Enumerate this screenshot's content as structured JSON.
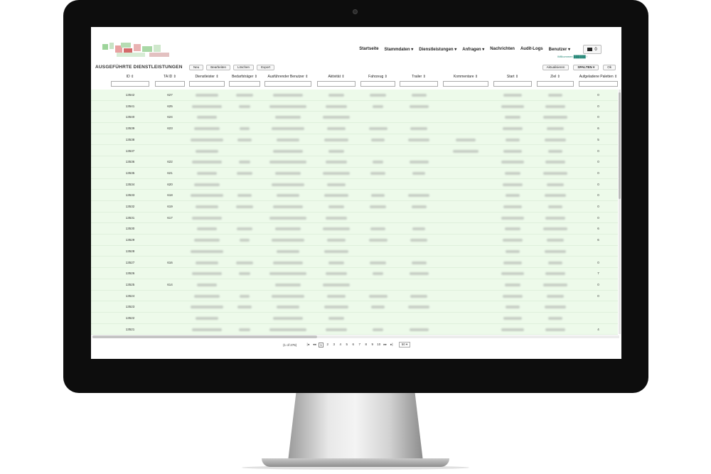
{
  "app": {
    "nav": [
      "Startseite",
      "Stammdaten ▾",
      "Dienstleistungen ▾",
      "Anfragen ▾",
      "Nachrichten",
      "Audit-Logs",
      "Benutzer ▾"
    ],
    "message_count": "0",
    "welcome_text": "Willkommen ██████ !",
    "page_title": "AUSGEFÜHRTE DIENSTLEISTUNGEN",
    "toolbar": [
      "Neu",
      "Bearbeiten",
      "Löschen",
      "Export"
    ],
    "right_tools": [
      "Aktualisieren",
      "SPALTEN ▾",
      "Ok"
    ]
  },
  "table": {
    "columns": [
      {
        "label": "ID ⇕"
      },
      {
        "label": "TA ID ⇕"
      },
      {
        "label": "Dienstleister ⇕"
      },
      {
        "label": "Bedarfsträger ⇕"
      },
      {
        "label": "Ausführender Benutzer ⇕"
      },
      {
        "label": "Aktivität ⇕"
      },
      {
        "label": "Fahrzeug ⇕"
      },
      {
        "label": "Trailer ⇕"
      },
      {
        "label": "Kommentare ⇕"
      },
      {
        "label": "Start ⇕"
      },
      {
        "label": "Ziel ⇕"
      },
      {
        "label": "Aufgeladene Paletten ⇕"
      }
    ],
    "rows": [
      {
        "id": "13542",
        "ta_id": "627",
        "paletten": "0"
      },
      {
        "id": "13541",
        "ta_id": "625",
        "paletten": "0"
      },
      {
        "id": "13540",
        "ta_id": "624",
        "paletten": "0"
      },
      {
        "id": "13539",
        "ta_id": "623",
        "paletten": "6"
      },
      {
        "id": "13538",
        "ta_id": "",
        "paletten": "5"
      },
      {
        "id": "13537",
        "ta_id": "",
        "paletten": "0"
      },
      {
        "id": "13536",
        "ta_id": "622",
        "paletten": "0"
      },
      {
        "id": "13535",
        "ta_id": "621",
        "paletten": "0"
      },
      {
        "id": "13534",
        "ta_id": "620",
        "paletten": "0"
      },
      {
        "id": "13533",
        "ta_id": "618",
        "paletten": "0"
      },
      {
        "id": "13532",
        "ta_id": "619",
        "paletten": "0"
      },
      {
        "id": "13531",
        "ta_id": "617",
        "paletten": "0"
      },
      {
        "id": "13530",
        "ta_id": "",
        "paletten": "6"
      },
      {
        "id": "13529",
        "ta_id": "",
        "paletten": "6"
      },
      {
        "id": "13528",
        "ta_id": "",
        "paletten": ""
      },
      {
        "id": "13527",
        "ta_id": "616",
        "paletten": "0"
      },
      {
        "id": "13526",
        "ta_id": "",
        "paletten": "7"
      },
      {
        "id": "13525",
        "ta_id": "614",
        "paletten": "0"
      },
      {
        "id": "13524",
        "ta_id": "",
        "paletten": "0"
      },
      {
        "id": "13523",
        "ta_id": "",
        "paletten": ""
      },
      {
        "id": "13522",
        "ta_id": "",
        "paletten": ""
      },
      {
        "id": "13521",
        "ta_id": "",
        "paletten": "4"
      }
    ]
  },
  "pager": {
    "info": "(1 of 276)",
    "first": "|◂",
    "prev": "◂◂",
    "pages": [
      "1",
      "2",
      "3",
      "4",
      "5",
      "6",
      "7",
      "8",
      "9",
      "10"
    ],
    "next": "▸▸",
    "last": "▸|",
    "page_size": "50 ▾"
  }
}
